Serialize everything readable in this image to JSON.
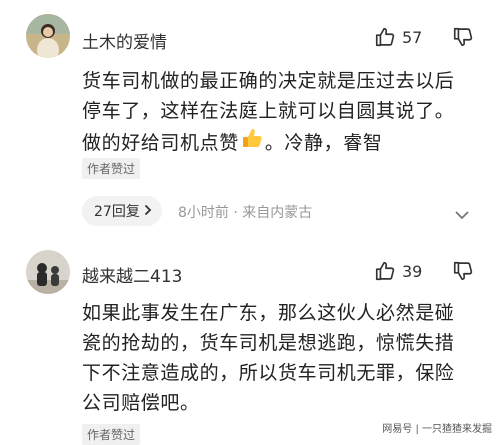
{
  "comments": [
    {
      "username": "土木的爱情",
      "likes": "57",
      "text_lines": [
        "货车司机做的最正确的决定就是压过去以后",
        "停车了，这样在法庭上就可以自圆其说了。",
        "做的好给司机点赞",
        "。冷静，睿智"
      ],
      "badge": "作者赞过",
      "reply_label": "27回复",
      "meta": "8小时前 · 来自内蒙古"
    },
    {
      "username": "越来越二413",
      "likes": "39",
      "text_lines": [
        "如果此事发生在广东，那么这伙人必然是碰",
        "瓷的抢劫的，货车司机是想逃跑，惊慌失措",
        "下不注意造成的，所以货车司机无罪，保险",
        "公司赔偿吧。"
      ],
      "badge": "作者赞过"
    }
  ],
  "icons": {
    "like": "thumbs-up-icon",
    "dislike": "thumbs-down-icon",
    "emoji": "thumbs-up-emoji-icon",
    "chevron": "chevron-right-icon",
    "more": "chevron-down-icon"
  },
  "watermark": "网易号 | 一只猹猹来发掘",
  "colors": {
    "text": "#222222",
    "meta": "#999999",
    "badge_bg": "#f0f0f0",
    "pill_bg": "#f2f2f2"
  }
}
